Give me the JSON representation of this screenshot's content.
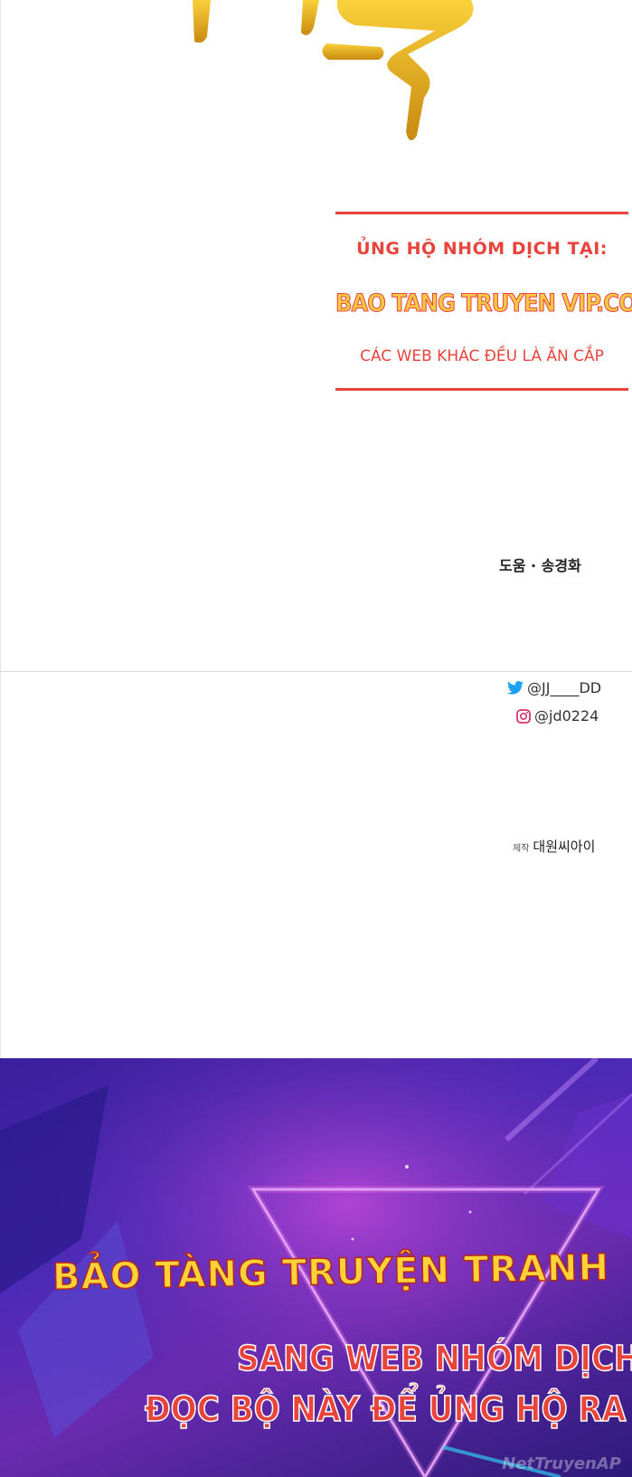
{
  "notice": {
    "line1": "ỦNG HỘ NHÓM DỊCH TẠI:",
    "line2": "BAO TANG TRUYEN VIP.COM",
    "line3": "CÁC WEB KHÁC ĐỀU LÀ ĂN CẮP"
  },
  "credits": {
    "assist": "도움 · 송경화",
    "twitter_handle": "@JJ____DD",
    "instagram_handle": "@jd0224",
    "production_label": "제작",
    "production_company": "대원씨아이"
  },
  "promo": {
    "title": "BẢO TÀNG TRUYỆN TRANH",
    "subtitle_line1": "SANG WEB NHÓM DỊCH",
    "subtitle_line2": "ĐỌC BỘ NÀY ĐỂ ỦNG HỘ RA C",
    "watermark": "NetTruyenAP"
  },
  "colors": {
    "accent_red": "#e8443c",
    "gold": "#f6c945",
    "promo_bg": "#4b2ab8"
  },
  "icons": [
    "twitter-bird-icon",
    "instagram-icon"
  ]
}
